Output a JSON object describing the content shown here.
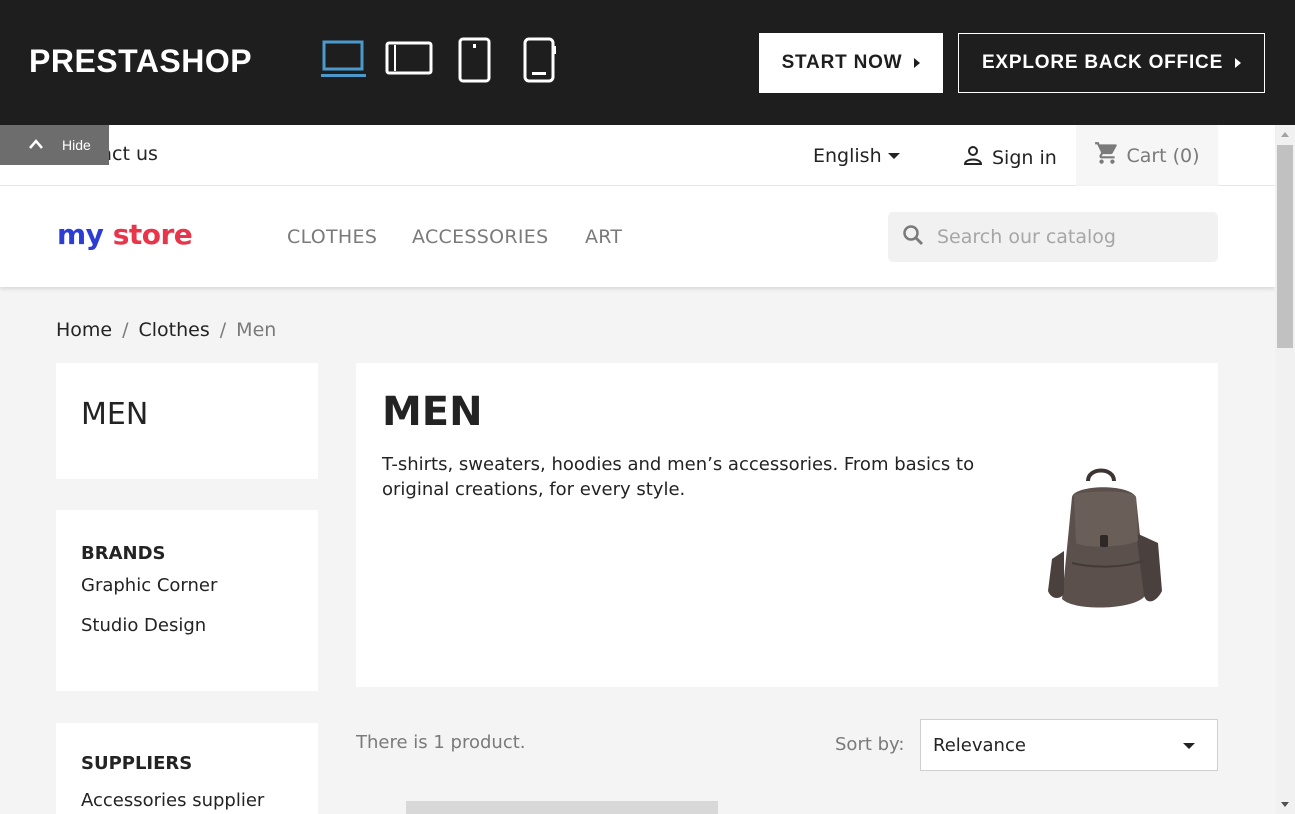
{
  "demo_bar": {
    "logo": "PRESTASHOP",
    "devices": [
      "desktop-icon",
      "tablet-landscape-icon",
      "tablet-portrait-icon",
      "mobile-icon"
    ],
    "active_device": "desktop",
    "start_now": "START NOW",
    "explore": "EXPLORE BACK OFFICE",
    "colors": {
      "bg": "#1e1e1e",
      "active": "#4a9acb"
    }
  },
  "hide_tab": {
    "label": "Hide"
  },
  "nav": {
    "contact": "Contact us",
    "language": "English",
    "signin": "Sign in",
    "cart": "Cart",
    "cart_count": "(0)"
  },
  "header": {
    "logo_words": [
      "my",
      "store"
    ],
    "menu": [
      "CLOTHES",
      "ACCESSORIES",
      "ART"
    ],
    "search_placeholder": "Search our catalog"
  },
  "breadcrumb": [
    "Home",
    "Clothes",
    "Men"
  ],
  "sidebar": {
    "title": "MEN",
    "brands_title": "BRANDS",
    "brands": [
      "Graphic Corner",
      "Studio Design"
    ],
    "suppliers_title": "SUPPLIERS",
    "suppliers": [
      "Accessories supplier"
    ]
  },
  "category": {
    "title": "MEN",
    "description": "T-shirts, sweaters, hoodies and men’s accessories. From basics to original creations, for every style."
  },
  "listing": {
    "count_text": "There is 1 product.",
    "sort_label": "Sort by:",
    "sort_value": "Relevance"
  }
}
